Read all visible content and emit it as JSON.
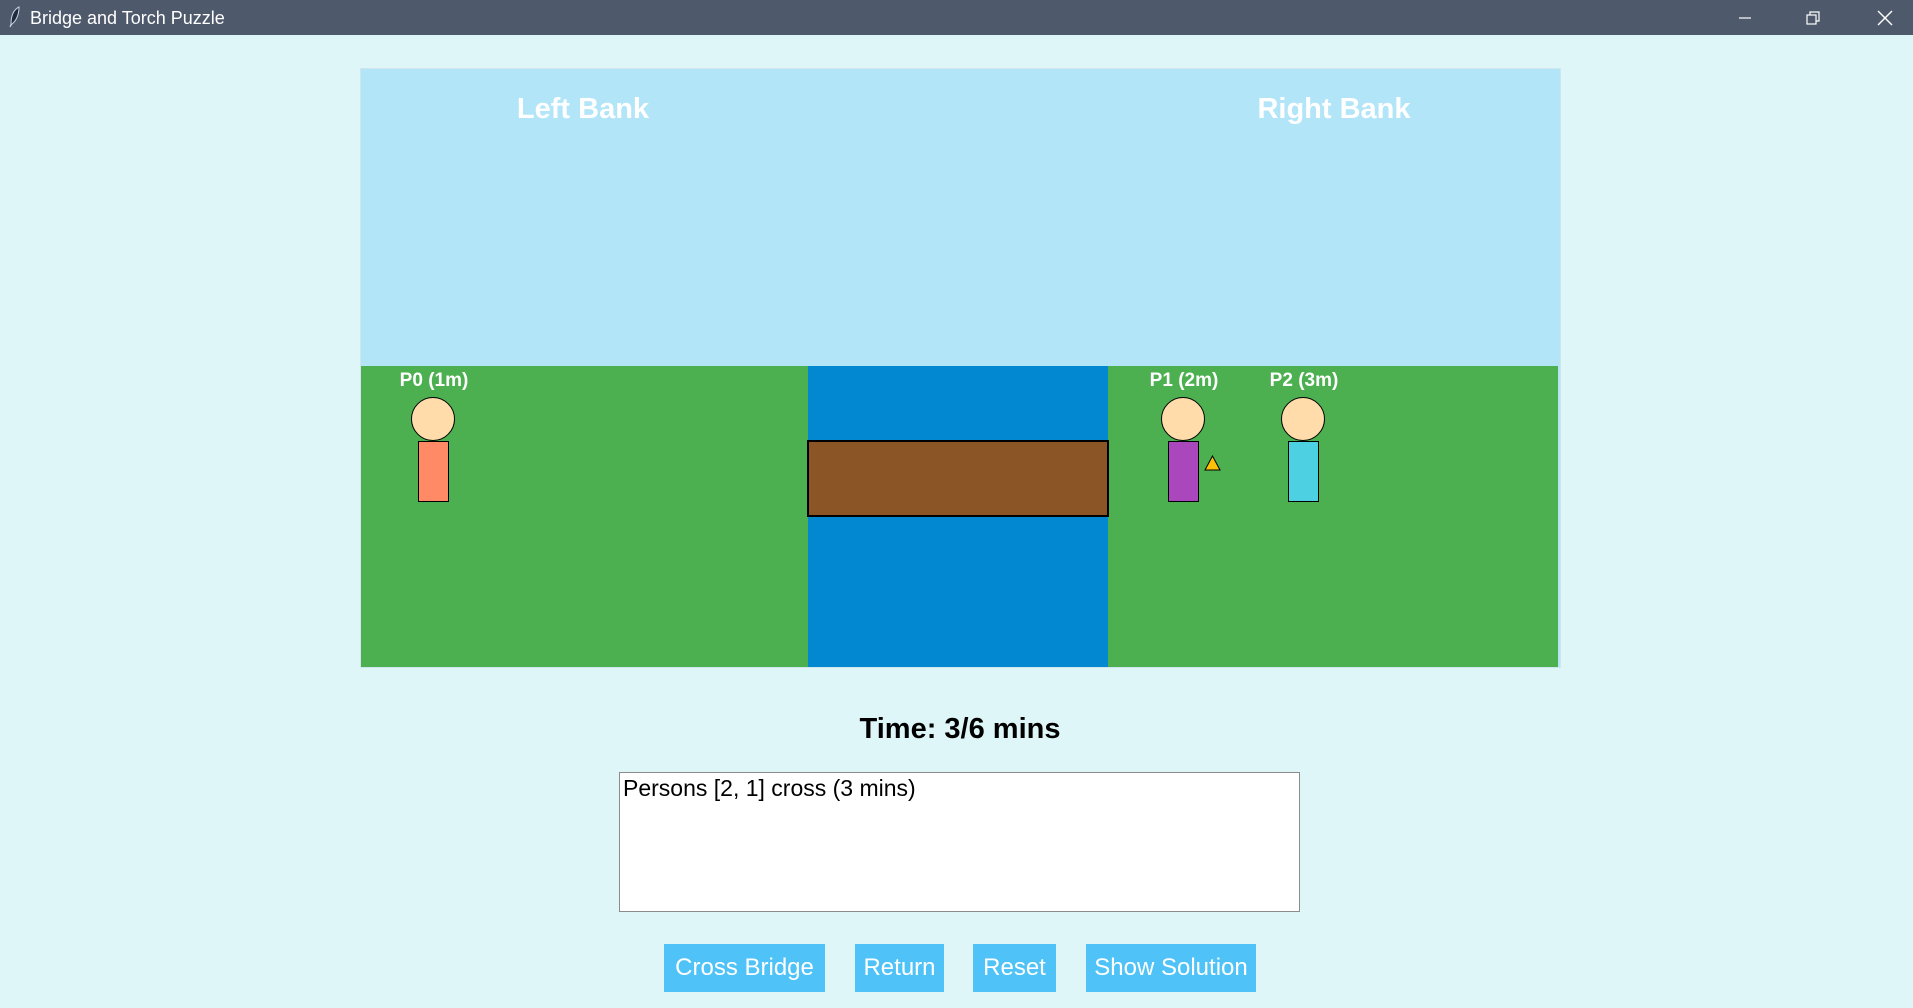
{
  "window": {
    "title": "Bridge and Torch Puzzle",
    "icon": "feather-icon"
  },
  "scene": {
    "left_bank_label": "Left Bank",
    "right_bank_label": "Right Bank",
    "colors": {
      "sky": "#b3e5f9",
      "grass": "#4caf50",
      "river": "#0288d1",
      "bridge": "#8b5525",
      "skin": "#ffdcaa",
      "torch": "#ffc107"
    },
    "people": [
      {
        "label": "P0 (1m)",
        "bank": "left",
        "color": "#ff8a65"
      },
      {
        "label": "P1 (2m)",
        "bank": "right",
        "color": "#ab47bc",
        "has_torch": true
      },
      {
        "label": "P2 (3m)",
        "bank": "right",
        "color": "#4dd0e1"
      }
    ],
    "torch_icon": "torch-triangle-icon"
  },
  "status": {
    "time_text": "Time: 3/6 mins",
    "log_text": "Persons [2, 1] cross (3 mins)"
  },
  "buttons": {
    "cross_bridge": "Cross Bridge",
    "return": "Return",
    "reset": "Reset",
    "show_solution": "Show Solution"
  }
}
